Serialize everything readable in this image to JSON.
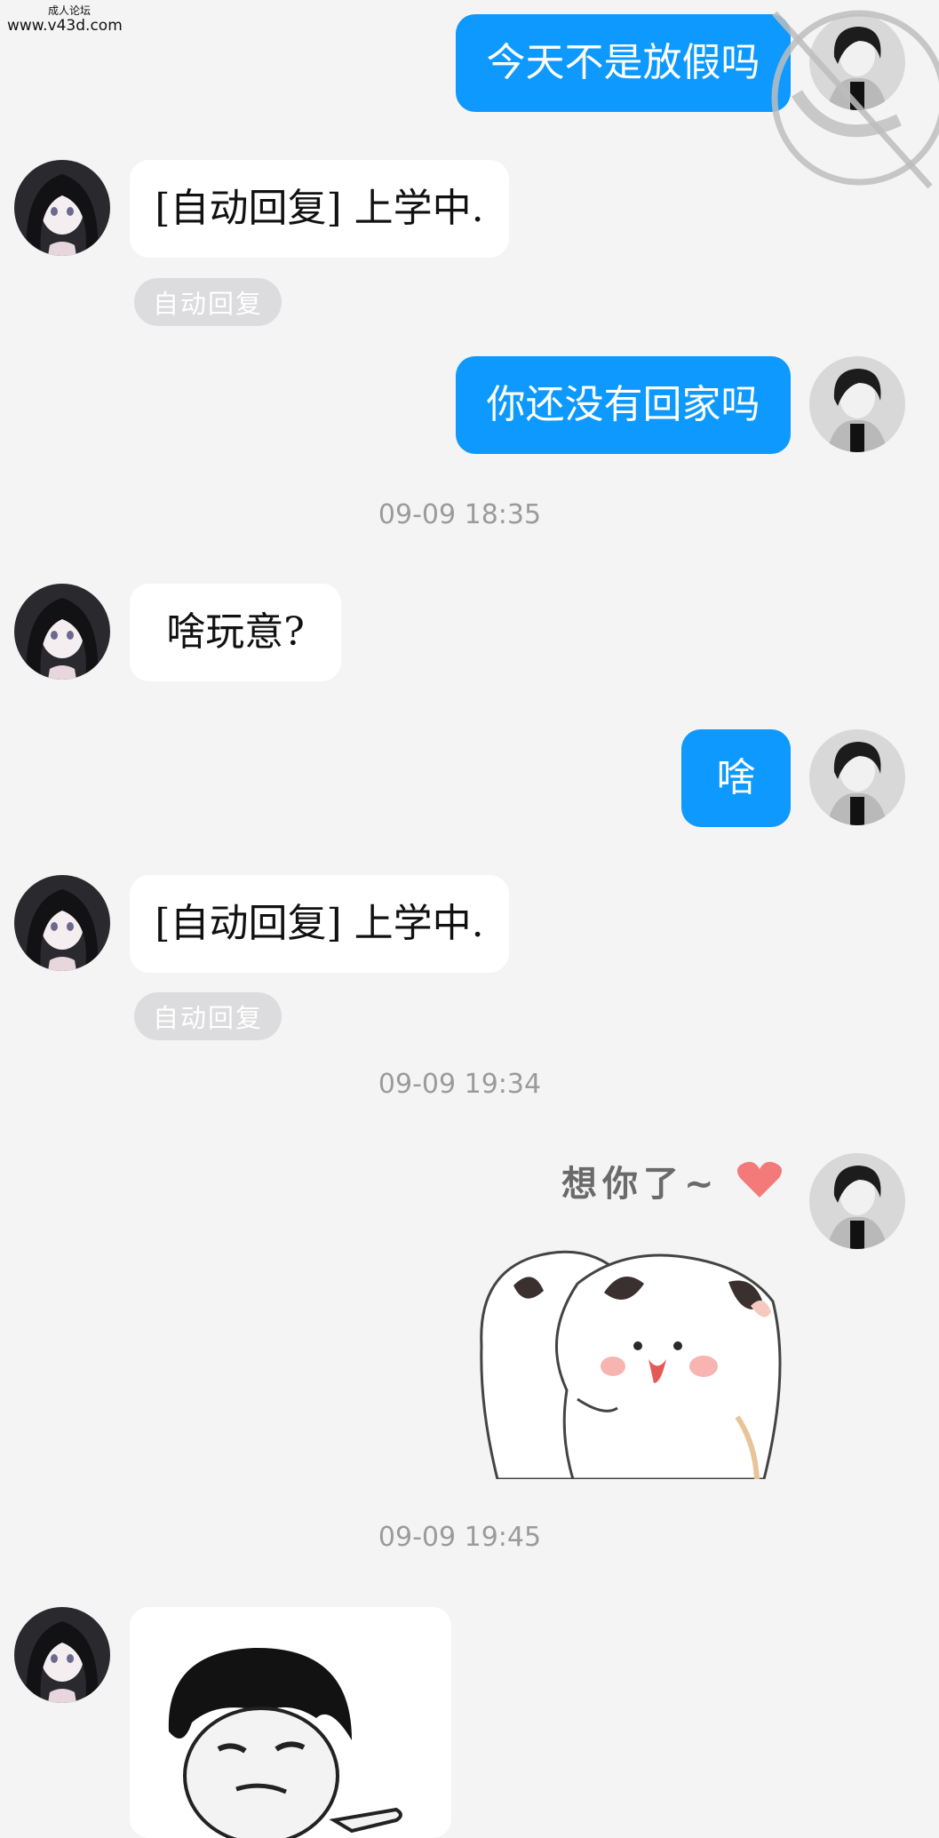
{
  "watermark": {
    "line1": "成人论坛",
    "line2": "www.v43d.com"
  },
  "messages": {
    "m1": {
      "text": "今天不是放假吗"
    },
    "m2": {
      "text": "[自动回复] 上学中."
    },
    "m2_tag": "自动回复",
    "m3": {
      "text": "你还没有回家吗"
    },
    "time1": "09-09 18:35",
    "m4": {
      "text": "啥玩意?"
    },
    "m5": {
      "text": "啥"
    },
    "m6": {
      "text": "[自动回复] 上学中."
    },
    "m6_tag": "自动回复",
    "time2": "09-09 19:34",
    "m7_sticker": {
      "text": "想你了~"
    },
    "time3": "09-09 19:45"
  },
  "colors": {
    "background": "#f4f4f5",
    "outgoing_bubble": "#0d99fe",
    "incoming_bubble": "#ffffff",
    "tag_bg": "#dcdcde",
    "timestamp": "#9b9b9b"
  }
}
